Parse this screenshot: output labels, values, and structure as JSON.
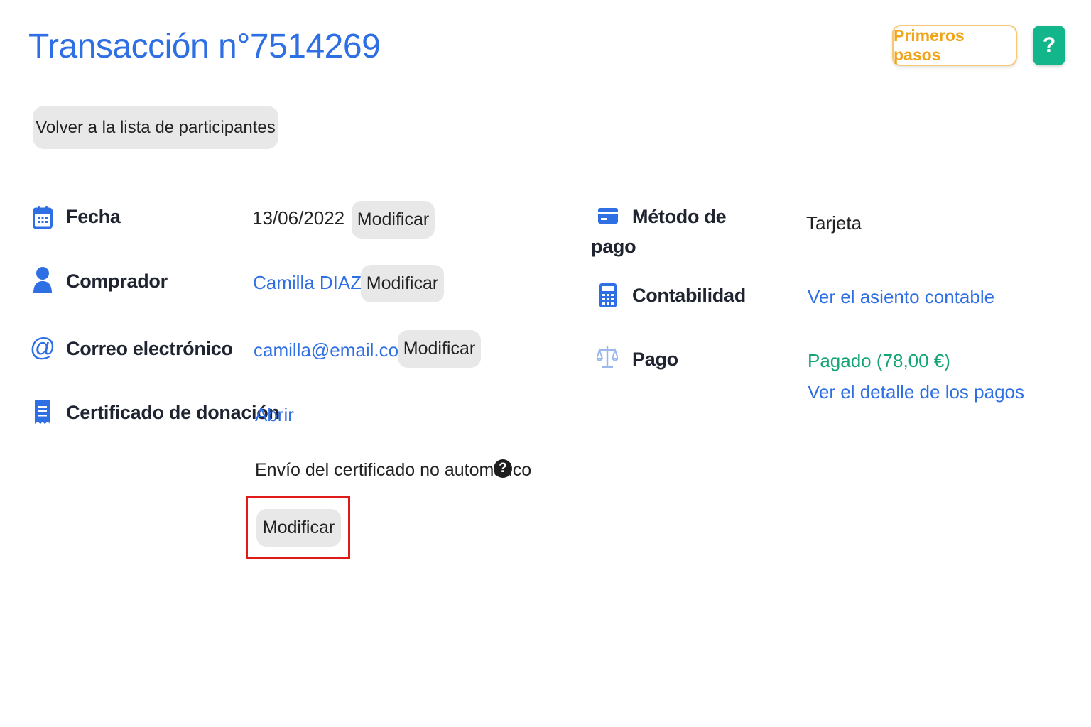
{
  "header": {
    "title": "Transacción n°7514269",
    "first_steps_label": "Primeros pasos",
    "help_label": "?"
  },
  "back_button_label": "Volver a la lista de participantes",
  "left_details": {
    "date": {
      "icon": "calendar-icon",
      "label": "Fecha",
      "value": "13/06/2022",
      "action": "Modificar"
    },
    "buyer": {
      "icon": "user-icon",
      "label": "Comprador",
      "value": "Camilla DIAZ",
      "action": "Modificar"
    },
    "email": {
      "icon": "at-icon",
      "label": "Correo electrónico",
      "value": "camilla@email.com",
      "action": "Modificar"
    },
    "certificate": {
      "icon": "receipt-icon",
      "label": "Certificado de donación",
      "open_link": "Abrir",
      "note": "Envío del certificado no automático",
      "note_help": "?",
      "action": "Modificar"
    }
  },
  "right_details": {
    "payment_method": {
      "icon": "credit-card-icon",
      "label_line1": "Método de",
      "label_line2": "pago",
      "value": "Tarjeta"
    },
    "accounting": {
      "icon": "calculator-icon",
      "label": "Contabilidad",
      "link": "Ver el asiento contable"
    },
    "payment": {
      "icon": "scale-icon",
      "label": "Pago",
      "status": "Pagado (78,00 €)",
      "details_link": "Ver el detalle de los pagos"
    }
  },
  "colors": {
    "primary": "#2f6fe4",
    "accent_orange": "#f0a419",
    "help_green": "#13b58a",
    "paid_green": "#14a476",
    "highlight_red": "#e01919",
    "pill_gray": "#e8e8e8"
  }
}
